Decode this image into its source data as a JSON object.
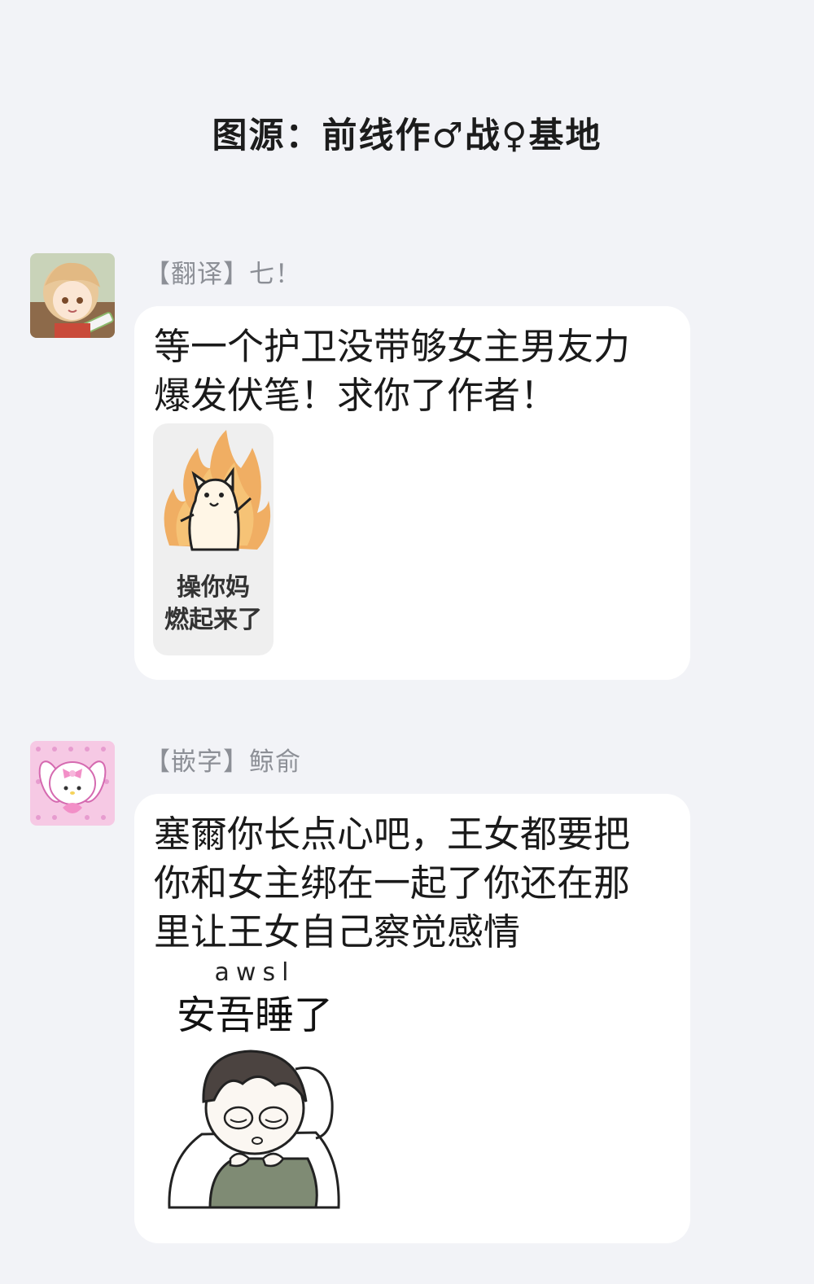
{
  "header": {
    "source": "图源：前线作♂战♀基地"
  },
  "messages": [
    {
      "sender": "【翻译】七！",
      "text_lines": [
        "等一个护卫没带够女主男友力",
        "爆发伏笔！求你了作者！"
      ],
      "sticker": {
        "icon": "flaming-dog-sticker",
        "caption_lines": [
          "操你妈",
          "燃起来了"
        ]
      }
    },
    {
      "sender": "【嵌字】鲸俞",
      "text_lines": [
        "塞爾你长点心吧，王女都要把",
        "你和女主绑在一起了你还在那",
        "里让王女自己察觉感情"
      ],
      "sticker": {
        "icon": "sleeping-person-sticker",
        "top_text": "awsl",
        "caption": "安吾睡了"
      }
    }
  ]
}
